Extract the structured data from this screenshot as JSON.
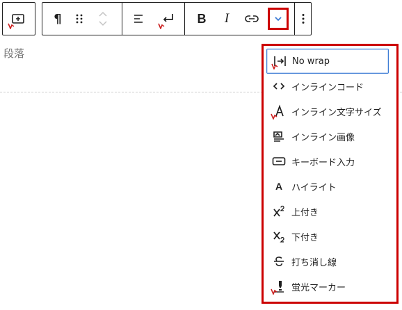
{
  "toolbar": {
    "add_block": {
      "icon": "add-block-icon"
    },
    "paragraph": {
      "icon": "pilcrow-icon"
    },
    "drag": {
      "icon": "drag-handle-icon"
    },
    "move": {
      "icon": "move-up-down-icon"
    },
    "align": {
      "icon": "align-left-icon"
    },
    "line_break": {
      "icon": "line-break-icon"
    },
    "bold": {
      "label": "B",
      "icon": "bold-icon"
    },
    "italic": {
      "label": "I",
      "icon": "italic-icon"
    },
    "link": {
      "icon": "link-icon"
    },
    "more_formats": {
      "icon": "chevron-down-icon",
      "highlight_color": "#cc0000"
    },
    "options": {
      "icon": "more-vertical-icon"
    }
  },
  "editor": {
    "placeholder_paragraph": "段落"
  },
  "dropdown": {
    "items": [
      {
        "label": "No wrap",
        "icon": "no-wrap-icon",
        "active": true
      },
      {
        "label": "インラインコード",
        "icon": "code-icon"
      },
      {
        "label": "インライン文字サイズ",
        "icon": "font-size-icon"
      },
      {
        "label": "インライン画像",
        "icon": "image-icon"
      },
      {
        "label": "キーボード入力",
        "icon": "keyboard-icon"
      },
      {
        "label": "ハイライト",
        "icon": "highlight-icon",
        "glyph": "A"
      },
      {
        "label": "上付き",
        "icon": "superscript-icon"
      },
      {
        "label": "下付き",
        "icon": "subscript-icon"
      },
      {
        "label": "打ち消し線",
        "icon": "strikethrough-icon"
      },
      {
        "label": "蛍光マーカー",
        "icon": "marker-icon"
      }
    ]
  },
  "colors": {
    "accent": "#3b7bd4",
    "highlight": "#cc0000",
    "text": "#1e1e1e",
    "muted": "#757575"
  }
}
